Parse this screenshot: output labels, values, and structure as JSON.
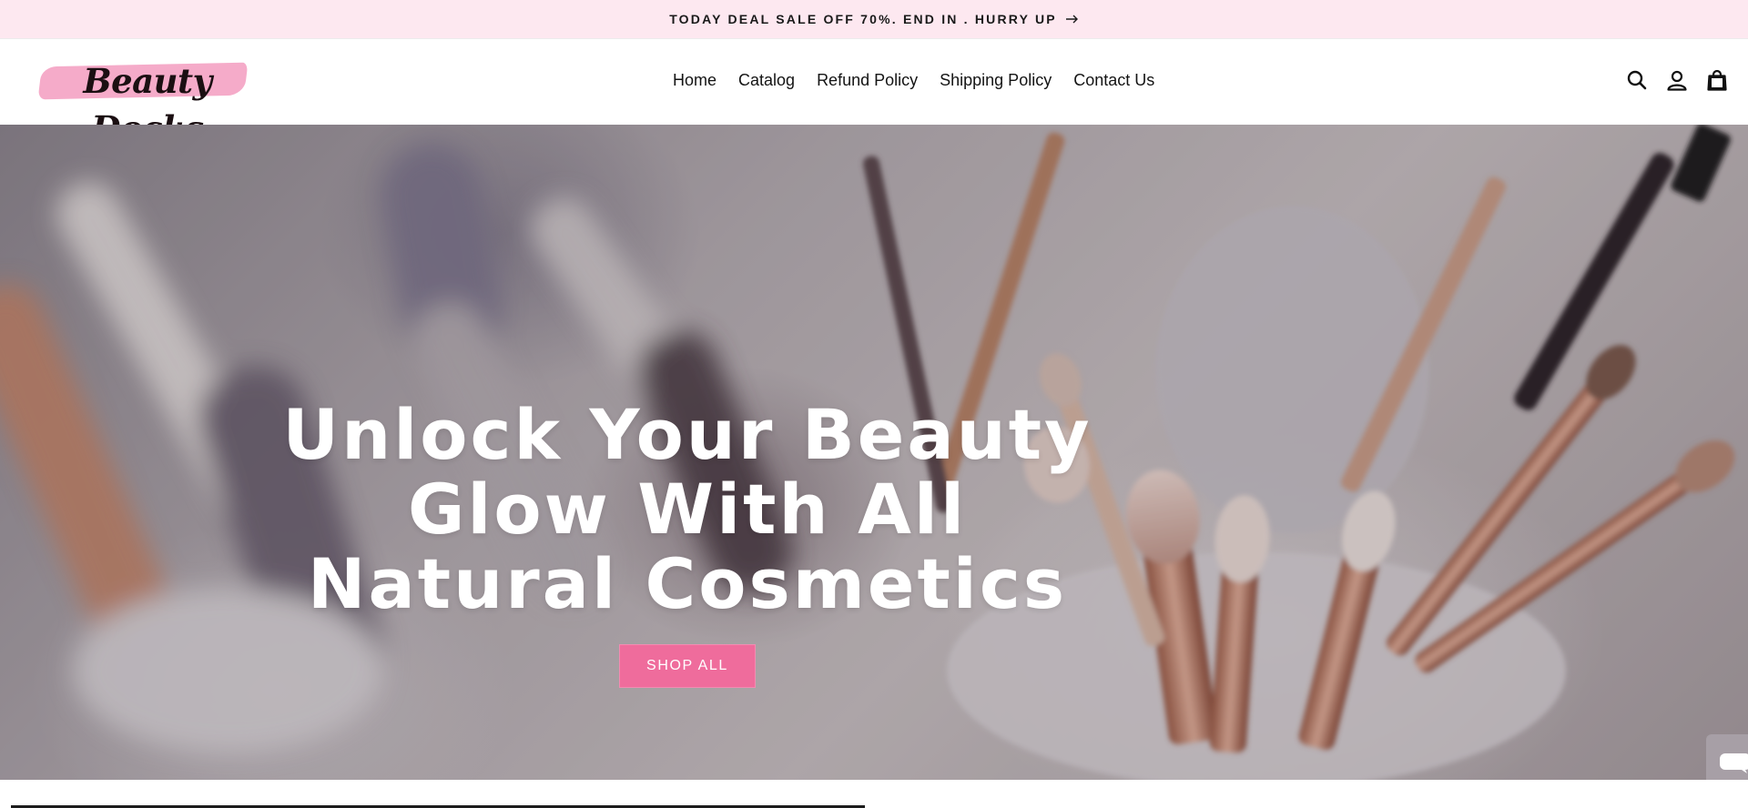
{
  "announcement": {
    "text": "TODAY DEAL SALE OFF 70%. END IN . HURRY UP",
    "icon": "arrow-right-icon"
  },
  "header": {
    "logo_text": "Beauty Docks",
    "nav": [
      {
        "label": "Home"
      },
      {
        "label": "Catalog"
      },
      {
        "label": "Refund Policy"
      },
      {
        "label": "Shipping Policy"
      },
      {
        "label": "Contact Us"
      }
    ],
    "icons": [
      "search-icon",
      "account-icon",
      "cart-icon"
    ]
  },
  "hero": {
    "title": "Unlock Your Beauty Glow With All Natural Cosmetics",
    "button_label": "SHOP ALL",
    "button_color": "#ef6c9c",
    "image": "makeup-brushes-photo"
  },
  "chat": {
    "icon": "chat-icon"
  },
  "colors": {
    "announcement_bg": "#fde8f0",
    "logo_swash": "#f4a6c6",
    "text": "#121212"
  }
}
